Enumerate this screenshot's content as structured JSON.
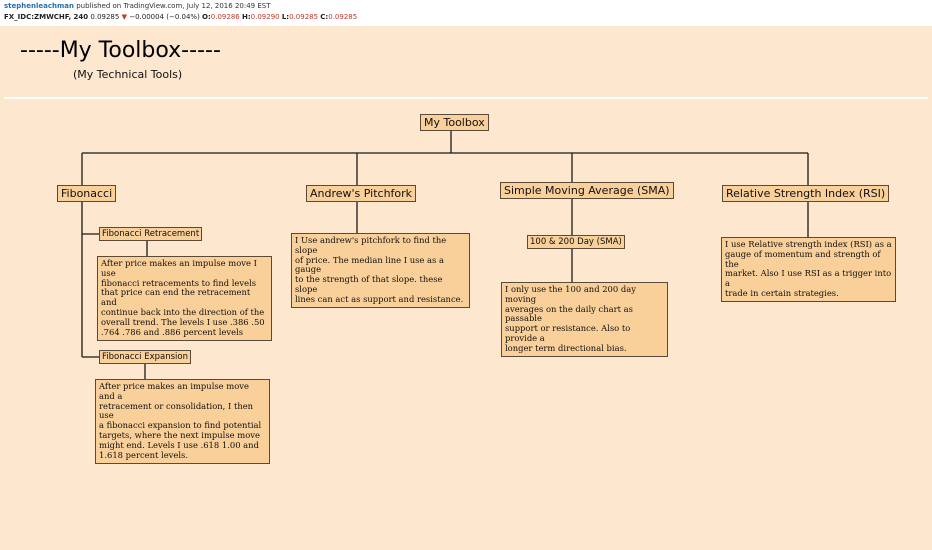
{
  "header": {
    "author": "stephenleachman",
    "published_text": "published on TradingView.com, July 12, 2016 20:49 EST",
    "symbol": "FX_IDC:ZMWCHF, 240",
    "last": "0.09285",
    "change_arrow": "▼",
    "change": "−0.00004 (−0.04%)",
    "open_label": "O:",
    "open": "0.09286",
    "high_label": "H:",
    "high": "0.09290",
    "low_label": "L:",
    "low": "0.09285",
    "close_label": "C:",
    "close": "0.09285"
  },
  "title": {
    "main": "-----My Toolbox-----",
    "subtitle": "(My Technical Tools)"
  },
  "tree": {
    "root": "My Toolbox",
    "fibonacci": {
      "label": "Fibonacci",
      "retracement": {
        "label": "Fibonacci Retracement",
        "note": "After price makes an impulse move I use\nfibonacci retracements to find levels\nthat price can end the retracement and\ncontinue back into the direction of the\noverall trend. The levels I use  .386 .50\n.764 .786 and .886 percent levels"
      },
      "expansion": {
        "label": "Fibonacci Expansion",
        "note": "After price makes an impulse move and a\nretracement or consolidation, I then use\na fibonacci expansion to find potential\ntargets, where the next impulse move\nmight end. Levels I use .618 1.00 and\n1.618 percent levels."
      }
    },
    "pitchfork": {
      "label": "Andrew's Pitchfork",
      "note": "I Use andrew's pitchfork to find the slope\nof price. The median line I use as a gauge\nto the strength of that slope. these slope\nlines can act as support and resistance."
    },
    "sma": {
      "label": "Simple Moving Average (SMA)",
      "sub_label": "100 & 200 Day (SMA)",
      "note": "I only use the 100 and 200 day moving\naverages on the daily chart as passable\nsupport or resistance. Also to provide a\nlonger term directional bias."
    },
    "rsi": {
      "label": "Relative Strength Index (RSI)",
      "note": "I use Relative strength index (RSI) as a\ngauge of momentum and strength of the\nmarket. Also I use RSI as a trigger into a\ntrade in certain strategies."
    }
  },
  "colors": {
    "background": "#fde7cf",
    "node_fill": "#f9cf9a",
    "node_border": "#5a4a3a",
    "author_link": "#2a6fb0",
    "price_red": "#c0392b"
  }
}
